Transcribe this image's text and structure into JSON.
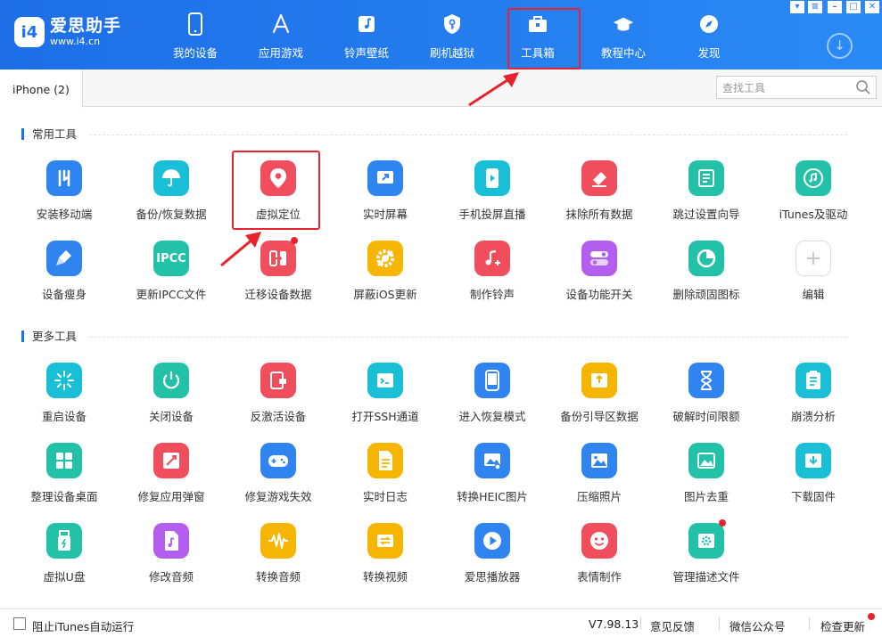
{
  "app": {
    "name": "爱思助手",
    "url": "www.i4.cn",
    "logo_text": "i4"
  },
  "nav": [
    {
      "label": "我的设备",
      "icon": "phone-icon"
    },
    {
      "label": "应用游戏",
      "icon": "app-store-icon"
    },
    {
      "label": "铃声壁纸",
      "icon": "music-icon"
    },
    {
      "label": "刷机越狱",
      "icon": "shield-key-icon"
    },
    {
      "label": "工具箱",
      "icon": "toolbox-icon",
      "active": true
    },
    {
      "label": "教程中心",
      "icon": "graduation-cap-icon"
    },
    {
      "label": "发现",
      "icon": "compass-icon"
    }
  ],
  "tab": {
    "label": "iPhone (2)"
  },
  "search": {
    "placeholder": "查找工具"
  },
  "sections": {
    "common": "常用工具",
    "more": "更多工具"
  },
  "common_tools": [
    {
      "label": "安装移动端",
      "icon": "i4-app-icon",
      "color": "#2f84f0"
    },
    {
      "label": "备份/恢复数据",
      "icon": "umbrella-icon",
      "color": "#19bfd6"
    },
    {
      "label": "虚拟定位",
      "icon": "location-pin-icon",
      "color": "#f04d5d"
    },
    {
      "label": "实时屏幕",
      "icon": "screen-share-icon",
      "color": "#2f84f0"
    },
    {
      "label": "手机投屏直播",
      "icon": "phone-play-icon",
      "color": "#19bfd6"
    },
    {
      "label": "抹除所有数据",
      "icon": "eraser-icon",
      "color": "#f04d5d"
    },
    {
      "label": "跳过设置向导",
      "icon": "checklist-icon",
      "color": "#22c1a8"
    },
    {
      "label": "iTunes及驱动",
      "icon": "itunes-icon",
      "color": "#22c1a8"
    },
    {
      "label": "设备瘦身",
      "icon": "broom-icon",
      "color": "#2f84f0"
    },
    {
      "label": "更新IPCC文件",
      "icon": "ipcc-icon",
      "color": "#22c1a8",
      "text": "IPCC"
    },
    {
      "label": "迁移设备数据",
      "icon": "migrate-icon",
      "color": "#f04d5d",
      "badge": true
    },
    {
      "label": "屏蔽iOS更新",
      "icon": "gear-block-icon",
      "color": "#f6b500"
    },
    {
      "label": "制作铃声",
      "icon": "music-note-plus-icon",
      "color": "#f04d5d"
    },
    {
      "label": "设备功能开关",
      "icon": "toggle-icon",
      "color": "#b45ef0"
    },
    {
      "label": "删除顽固图标",
      "icon": "pie-chart-icon",
      "color": "#22c1a8"
    },
    {
      "label": "编辑",
      "icon": "plus-icon",
      "color": "#ffffff"
    }
  ],
  "more_tools": [
    {
      "label": "重启设备",
      "icon": "restart-icon",
      "color": "#19bfd6"
    },
    {
      "label": "关闭设备",
      "icon": "power-icon",
      "color": "#22c1a8"
    },
    {
      "label": "反激活设备",
      "icon": "deactivate-icon",
      "color": "#f04d5d"
    },
    {
      "label": "打开SSH通道",
      "icon": "terminal-icon",
      "color": "#19bfd6"
    },
    {
      "label": "进入恢复模式",
      "icon": "recovery-phone-icon",
      "color": "#2f84f0"
    },
    {
      "label": "备份引导区数据",
      "icon": "backup-drive-icon",
      "color": "#f6b500"
    },
    {
      "label": "破解时间限额",
      "icon": "hourglass-icon",
      "color": "#2f84f0"
    },
    {
      "label": "崩溃分析",
      "icon": "clipboard-list-icon",
      "color": "#19bfd6"
    },
    {
      "label": "整理设备桌面",
      "icon": "grid-icon",
      "color": "#22c1a8"
    },
    {
      "label": "修复应用弹窗",
      "icon": "repair-icon",
      "color": "#f04d5d"
    },
    {
      "label": "修复游戏失效",
      "icon": "gamepad-icon",
      "color": "#2f84f0"
    },
    {
      "label": "实时日志",
      "icon": "document-icon",
      "color": "#f6b500"
    },
    {
      "label": "转换HEIC图片",
      "icon": "image-convert-icon",
      "color": "#2f84f0"
    },
    {
      "label": "压缩照片",
      "icon": "image-icon",
      "color": "#2f84f0"
    },
    {
      "label": "图片去重",
      "icon": "image-dedupe-icon",
      "color": "#22c1a8"
    },
    {
      "label": "下载固件",
      "icon": "download-box-icon",
      "color": "#19bfd6"
    },
    {
      "label": "虚拟U盘",
      "icon": "usb-icon",
      "color": "#22c1a8"
    },
    {
      "label": "修改音频",
      "icon": "audio-file-icon",
      "color": "#b45ef0"
    },
    {
      "label": "转换音频",
      "icon": "waveform-icon",
      "color": "#f6b500"
    },
    {
      "label": "转换视频",
      "icon": "video-convert-icon",
      "color": "#f6b500"
    },
    {
      "label": "爱思播放器",
      "icon": "play-icon",
      "color": "#2f84f0"
    },
    {
      "label": "表情制作",
      "icon": "smiley-icon",
      "color": "#f04d5d"
    },
    {
      "label": "管理描述文件",
      "icon": "gear-file-icon",
      "color": "#22c1a8",
      "badge": true
    }
  ],
  "footer": {
    "itunes_checkbox": "阻止iTunes自动运行",
    "version": "V7.98.13",
    "feedback": "意见反馈",
    "wechat": "微信公众号",
    "update": "检查更新"
  }
}
